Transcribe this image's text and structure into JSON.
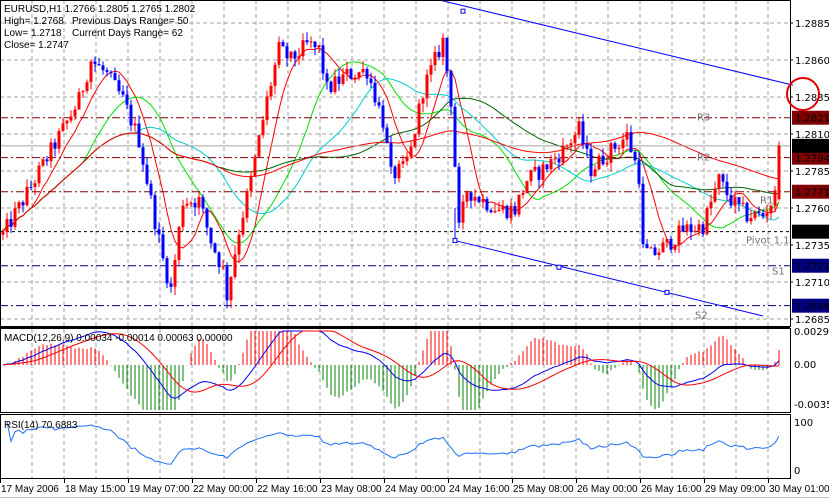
{
  "chart_data": {
    "type": "candlestick",
    "symbol_line": "EURUSD,H1  1.2766 1.2805 1.2765 1.2802",
    "info": {
      "high": "High= 1.2768",
      "low": "Low= 1.2718",
      "close": "Close= 1.2747",
      "prev_range": "Previous Days Range= 50",
      "curr_range": "Current Days Range= 62"
    },
    "last_bar": {
      "open": 1.2766,
      "high": 1.2805,
      "low": 1.2765,
      "close": 1.2802
    },
    "price_range": [
      1.2676,
      1.2905
    ],
    "price_ticks": [
      "1.2885",
      "1.2860",
      "1.2835",
      "1.2810",
      "1.2785",
      "1.2760",
      "1.2735",
      "1.2710",
      "1.2685"
    ],
    "anchors": [
      [
        0,
        1.2742
      ],
      [
        5,
        1.2765
      ],
      [
        10,
        1.2789
      ],
      [
        15,
        1.2813
      ],
      [
        19,
        1.2833
      ],
      [
        22,
        1.286
      ],
      [
        26,
        1.285
      ],
      [
        30,
        1.2833
      ],
      [
        34,
        1.2806
      ],
      [
        37,
        1.2765
      ],
      [
        40,
        1.2725
      ],
      [
        42,
        1.2705
      ],
      [
        45,
        1.2765
      ],
      [
        49,
        1.2765
      ],
      [
        52,
        1.2738
      ],
      [
        55,
        1.2718
      ],
      [
        56,
        1.2701
      ],
      [
        59,
        1.2745
      ],
      [
        62,
        1.2779
      ],
      [
        66,
        1.2833
      ],
      [
        69,
        1.2867
      ],
      [
        72,
        1.286
      ],
      [
        76,
        1.287
      ],
      [
        79,
        1.2867
      ],
      [
        81,
        1.284
      ],
      [
        86,
        1.285
      ],
      [
        91,
        1.2853
      ],
      [
        95,
        1.2819
      ],
      [
        97,
        1.2782
      ],
      [
        100,
        1.2786
      ],
      [
        102,
        1.2799
      ],
      [
        105,
        1.284
      ],
      [
        107,
        1.2853
      ],
      [
        110,
        1.2873
      ],
      [
        112,
        1.2833
      ],
      [
        114,
        1.2745
      ],
      [
        116,
        1.2772
      ],
      [
        120,
        1.2765
      ],
      [
        124,
        1.2759
      ],
      [
        128,
        1.2759
      ],
      [
        131,
        1.2779
      ],
      [
        135,
        1.2786
      ],
      [
        140,
        1.2799
      ],
      [
        144,
        1.2813
      ],
      [
        147,
        1.2786
      ],
      [
        152,
        1.2799
      ],
      [
        156,
        1.2809
      ],
      [
        159,
        1.2782
      ],
      [
        160,
        1.2732
      ],
      [
        162,
        1.2728
      ],
      [
        166,
        1.2735
      ],
      [
        170,
        1.2745
      ],
      [
        175,
        1.2748
      ],
      [
        179,
        1.2779
      ],
      [
        182,
        1.2765
      ],
      [
        186,
        1.2755
      ],
      [
        190,
        1.2755
      ],
      [
        193,
        1.2768
      ],
      [
        194,
        1.2802
      ]
    ],
    "pivots": [
      {
        "name": "R3",
        "value": 1.2821,
        "label": "R3",
        "price_label": "1.2821",
        "color": "#800000"
      },
      {
        "name": "R2",
        "value": 1.2794,
        "label": "R2",
        "price_label": "1.2794",
        "color": "#800000"
      },
      {
        "name": "R1",
        "value": 1.2771,
        "label": "R1",
        "price_label": "1.2771",
        "color": "#800000"
      },
      {
        "name": "Pivot",
        "value": 1.2744,
        "label": "Pivot  1.1",
        "price_label": "1.2744",
        "color": "#000000"
      },
      {
        "name": "S1",
        "value": 1.2721,
        "label": "S1",
        "price_label": "1.2721",
        "color": "#000080"
      },
      {
        "name": "S2",
        "value": 1.2694,
        "label": "S2",
        "price_label": "1.2694",
        "color": "#000080"
      }
    ],
    "current_price": {
      "value": 1.2802,
      "label": "1.2802",
      "color": "#000000"
    },
    "moving_averages": [
      {
        "period": 8,
        "color": "#ff0000"
      },
      {
        "period": 21,
        "color": "#00dd00"
      },
      {
        "period": 34,
        "color": "#00cccc"
      },
      {
        "period": 55,
        "color": "#006400"
      },
      {
        "period": 100,
        "color": "#ff0000"
      }
    ],
    "channel": {
      "upper": [
        [
          94.5,
          1.291
        ],
        [
          197.5,
          1.2843
        ]
      ],
      "lower": [
        [
          113,
          1.2738
        ],
        [
          190,
          1.2687
        ]
      ],
      "color": "#0000ff"
    },
    "colors": {
      "bull": "#ff0000",
      "bear": "#0000ff",
      "grid": "#a0a0a0",
      "highlight_circle": "#e00000"
    },
    "macd": {
      "label": "MACD(12,26,9) 0.00034 -0.00014 0.00063 0.00000",
      "params": [
        12,
        26,
        9
      ],
      "range": [
        -0.00354,
        0.00295
      ],
      "ticks": [
        "0.00295",
        "0.00",
        "-0.00354"
      ]
    },
    "rsi": {
      "label": "RSI(14) 70.6883",
      "period": 14,
      "value": 70.6883,
      "ticks": [
        "100",
        "0"
      ]
    },
    "time_labels": [
      "17 May 2006",
      "18 May 15:00",
      "19 May 07:00",
      "22 May 00:00",
      "22 May 16:00",
      "23 May 08:00",
      "24 May 00:00",
      "24 May 16:00",
      "25 May 08:00",
      "26 May 00:00",
      "26 May 16:00",
      "29 May 09:00",
      "30 May 01:00"
    ]
  }
}
